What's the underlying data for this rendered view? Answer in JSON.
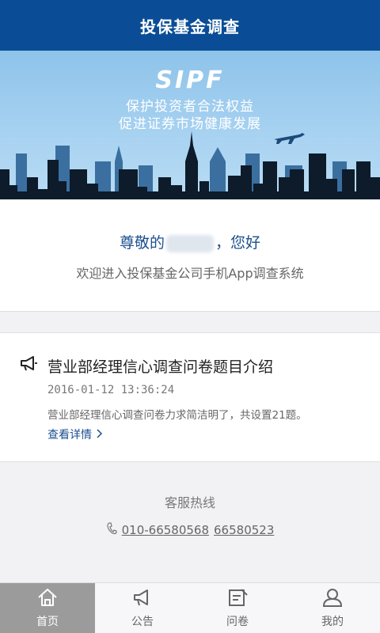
{
  "header": {
    "title": "投保基金调查"
  },
  "banner": {
    "logo": "SIPF",
    "slogan_line1": "保护投资者合法权益",
    "slogan_line2": "促进证券市场健康发展"
  },
  "welcome": {
    "greeting_prefix": "尊敬的",
    "greeting_suffix": "，您好",
    "message": "欢迎进入投保基金公司手机App调查系统"
  },
  "notice": {
    "icon": "megaphone-icon",
    "title": "营业部经理信心调查问卷题目介绍",
    "date": "2016-01-12 13:36:24",
    "summary": "营业部经理信心调查问卷力求简洁明了，共设置21题。",
    "more_label": "查看详情"
  },
  "hotline": {
    "label": "客服热线",
    "number1": "010-66580568",
    "number2": "66580523"
  },
  "tabs": [
    {
      "label": "首页",
      "icon": "home-icon",
      "active": true
    },
    {
      "label": "公告",
      "icon": "megaphone-icon",
      "active": false
    },
    {
      "label": "问卷",
      "icon": "questionnaire-icon",
      "active": false
    },
    {
      "label": "我的",
      "icon": "user-icon",
      "active": false
    }
  ],
  "colors": {
    "header_bg": "#0a4d96",
    "accent_text": "#1b4f8f",
    "active_tab_bg": "#9b9b9b"
  }
}
